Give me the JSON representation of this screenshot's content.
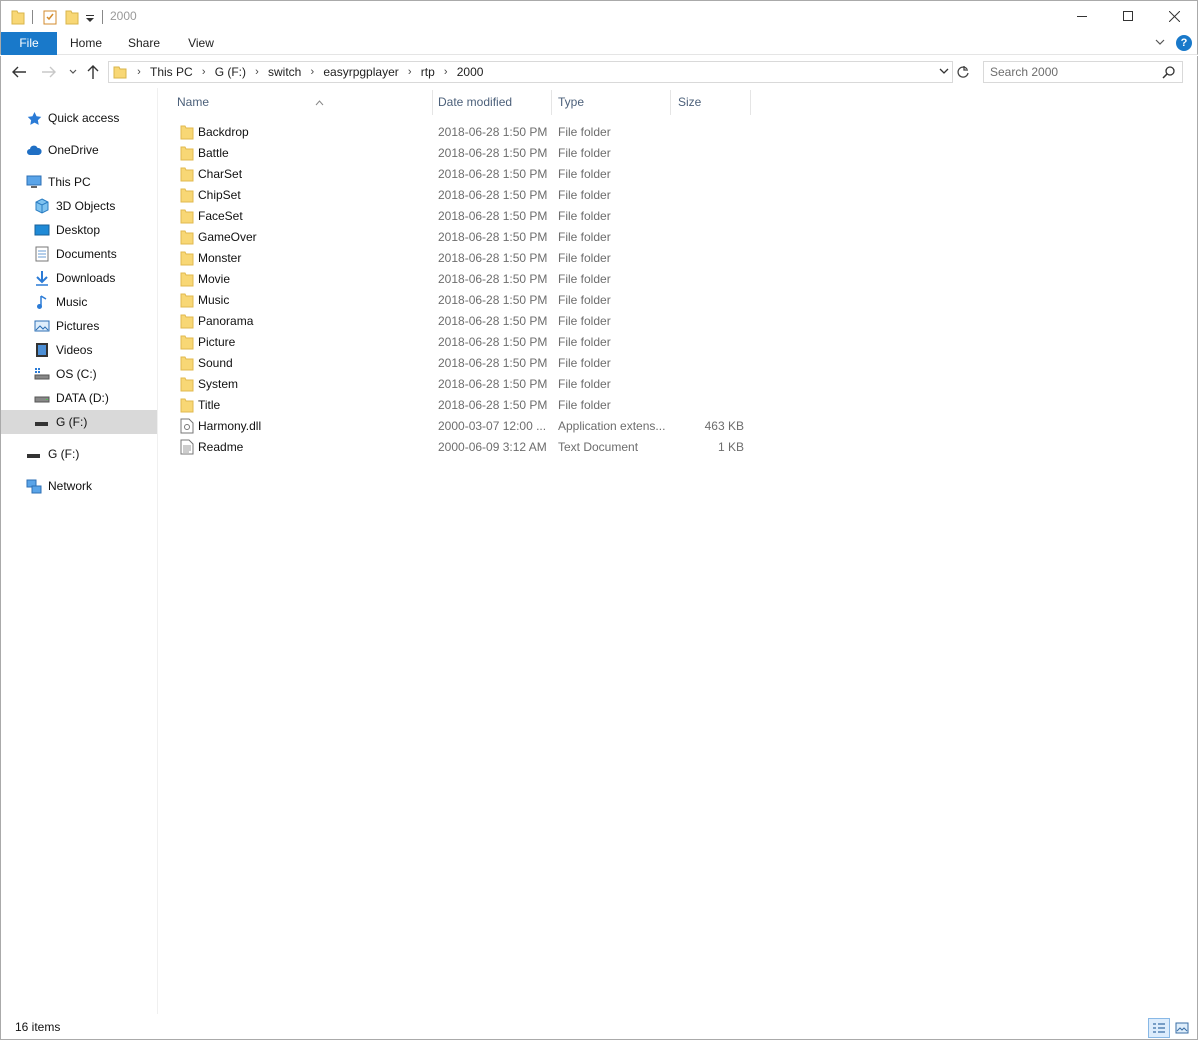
{
  "window": {
    "title": "2000"
  },
  "ribbon": {
    "tabs": [
      "File",
      "Home",
      "Share",
      "View"
    ]
  },
  "address": {
    "crumbs": [
      "This PC",
      "G (F:)",
      "switch",
      "easyrpgplayer",
      "rtp",
      "2000"
    ]
  },
  "search": {
    "placeholder": "Search 2000"
  },
  "sidebar": {
    "items": [
      {
        "label": "Quick access",
        "icon": "star-icon"
      },
      {
        "label": "OneDrive",
        "icon": "cloud-icon"
      },
      {
        "label": "This PC",
        "icon": "computer-icon"
      },
      {
        "label": "3D Objects",
        "icon": "cube-icon"
      },
      {
        "label": "Desktop",
        "icon": "desktop-icon"
      },
      {
        "label": "Documents",
        "icon": "document-icon"
      },
      {
        "label": "Downloads",
        "icon": "download-icon"
      },
      {
        "label": "Music",
        "icon": "music-icon"
      },
      {
        "label": "Pictures",
        "icon": "picture-icon"
      },
      {
        "label": "Videos",
        "icon": "video-icon"
      },
      {
        "label": "OS (C:)",
        "icon": "os-drive-icon"
      },
      {
        "label": "DATA (D:)",
        "icon": "drive-icon"
      },
      {
        "label": "G (F:)",
        "icon": "drive-icon"
      },
      {
        "label": "G (F:)",
        "icon": "drive-icon"
      },
      {
        "label": "Network",
        "icon": "network-icon"
      }
    ]
  },
  "columns": {
    "name": "Name",
    "date": "Date modified",
    "type": "Type",
    "size": "Size"
  },
  "files": [
    {
      "name": "Backdrop",
      "date": "2018-06-28 1:50 PM",
      "type": "File folder",
      "size": "",
      "kind": "folder"
    },
    {
      "name": "Battle",
      "date": "2018-06-28 1:50 PM",
      "type": "File folder",
      "size": "",
      "kind": "folder"
    },
    {
      "name": "CharSet",
      "date": "2018-06-28 1:50 PM",
      "type": "File folder",
      "size": "",
      "kind": "folder"
    },
    {
      "name": "ChipSet",
      "date": "2018-06-28 1:50 PM",
      "type": "File folder",
      "size": "",
      "kind": "folder"
    },
    {
      "name": "FaceSet",
      "date": "2018-06-28 1:50 PM",
      "type": "File folder",
      "size": "",
      "kind": "folder"
    },
    {
      "name": "GameOver",
      "date": "2018-06-28 1:50 PM",
      "type": "File folder",
      "size": "",
      "kind": "folder"
    },
    {
      "name": "Monster",
      "date": "2018-06-28 1:50 PM",
      "type": "File folder",
      "size": "",
      "kind": "folder"
    },
    {
      "name": "Movie",
      "date": "2018-06-28 1:50 PM",
      "type": "File folder",
      "size": "",
      "kind": "folder"
    },
    {
      "name": "Music",
      "date": "2018-06-28 1:50 PM",
      "type": "File folder",
      "size": "",
      "kind": "folder"
    },
    {
      "name": "Panorama",
      "date": "2018-06-28 1:50 PM",
      "type": "File folder",
      "size": "",
      "kind": "folder"
    },
    {
      "name": "Picture",
      "date": "2018-06-28 1:50 PM",
      "type": "File folder",
      "size": "",
      "kind": "folder"
    },
    {
      "name": "Sound",
      "date": "2018-06-28 1:50 PM",
      "type": "File folder",
      "size": "",
      "kind": "folder"
    },
    {
      "name": "System",
      "date": "2018-06-28 1:50 PM",
      "type": "File folder",
      "size": "",
      "kind": "folder"
    },
    {
      "name": "Title",
      "date": "2018-06-28 1:50 PM",
      "type": "File folder",
      "size": "",
      "kind": "folder"
    },
    {
      "name": "Harmony.dll",
      "date": "2000-03-07 12:00 ...",
      "type": "Application extens...",
      "size": "463 KB",
      "kind": "dll"
    },
    {
      "name": "Readme",
      "date": "2000-06-09 3:12 AM",
      "type": "Text Document",
      "size": "1 KB",
      "kind": "text"
    }
  ],
  "status": {
    "items": "16 items"
  },
  "colors": {
    "accent": "#1979ca",
    "folder": "#f8d775",
    "selected": "#d9d9d9"
  }
}
